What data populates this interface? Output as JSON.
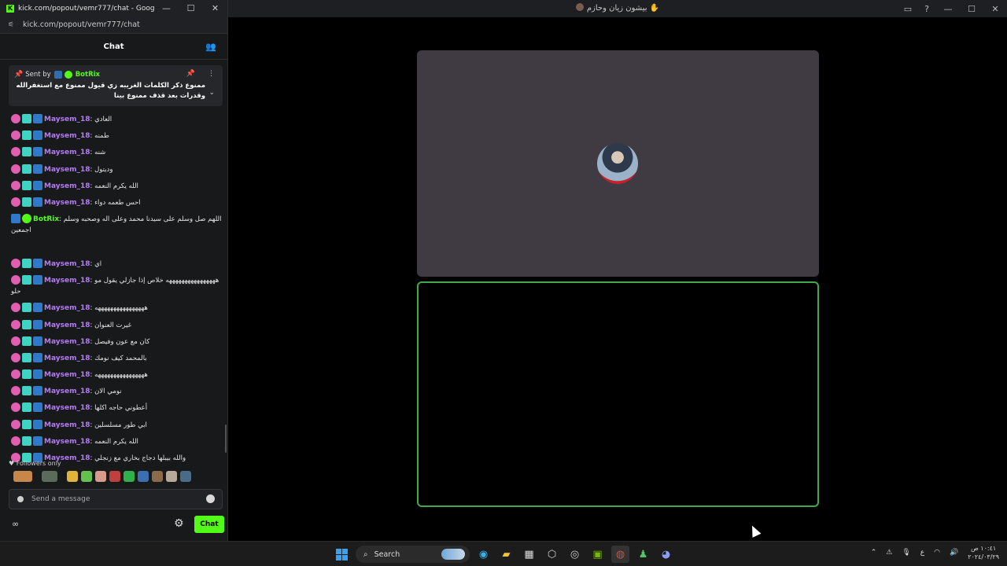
{
  "call_window": {
    "title": "بيشون زيان وحازم ✋",
    "controls": [
      "inbox-icon",
      "help-icon"
    ]
  },
  "browser": {
    "window_title": "kick.com/popout/vemr777/chat - Google Chro...",
    "address": "kick.com/popout/vemr777/chat"
  },
  "chat": {
    "header_title": "Chat",
    "pinned": {
      "sent_by_label": "Sent by",
      "sender": "BotRix",
      "text": "ممنوع ذكر الكلمات الغريبه زي قيول ممنوع مع استغفرالله وقدرات بعد قذف ممنوع بينا"
    },
    "messages": [
      {
        "user": "Maysem_18",
        "text": "العادي",
        "bot": false
      },
      {
        "user": "Maysem_18",
        "text": "طمنه",
        "bot": false
      },
      {
        "user": "Maysem_18",
        "text": "شنه",
        "bot": false
      },
      {
        "user": "Maysem_18",
        "text": "وديتول",
        "bot": false
      },
      {
        "user": "Maysem_18",
        "text": "الله يكرم النعمه",
        "bot": false
      },
      {
        "user": "Maysem_18",
        "text": "احس طعمه دواء",
        "bot": false
      },
      {
        "user": "BotRix",
        "text": "اللهم صل وسلم على سيدنا محمد وعلى اله وصحبه وسلم اجمعين",
        "bot": true
      },
      {
        "user": "Maysem_18",
        "text": "اي",
        "bot": false
      },
      {
        "user": "Maysem_18",
        "text": "ههههههههههههههههه خلاص إذا جازلي يقول مو حلو",
        "bot": false
      },
      {
        "user": "Maysem_18",
        "text": "ههههههههههههههههه",
        "bot": false
      },
      {
        "user": "Maysem_18",
        "text": "غيرت العنوان",
        "bot": false
      },
      {
        "user": "Maysem_18",
        "text": "كان مع عون وفيصل",
        "bot": false
      },
      {
        "user": "Maysem_18",
        "text": "بالمحمد كيف نومك",
        "bot": false
      },
      {
        "user": "Maysem_18",
        "text": "ههههههههههههههههه",
        "bot": false
      },
      {
        "user": "Maysem_18",
        "text": "نومي الان",
        "bot": false
      },
      {
        "user": "Maysem_18",
        "text": "أعطوني حاجه اكلها",
        "bot": false
      },
      {
        "user": "Maysem_18",
        "text": "ابي طور مسلسلين",
        "bot": false
      },
      {
        "user": "Maysem_18",
        "text": "الله يكرم النعمه",
        "bot": false
      },
      {
        "user": "Maysem_18",
        "text": "والله بيبلها دجاج بخاري مع زنجلي",
        "bot": false
      }
    ],
    "followers_only": "Followers only",
    "input_placeholder": "Send a message",
    "send_label": "Chat"
  },
  "taskbar": {
    "search_label": "Search",
    "clock_time": "١٠:٤١ ص",
    "clock_date": "٢٠٢٤/٠٣/٢٩",
    "ime": "ع"
  }
}
